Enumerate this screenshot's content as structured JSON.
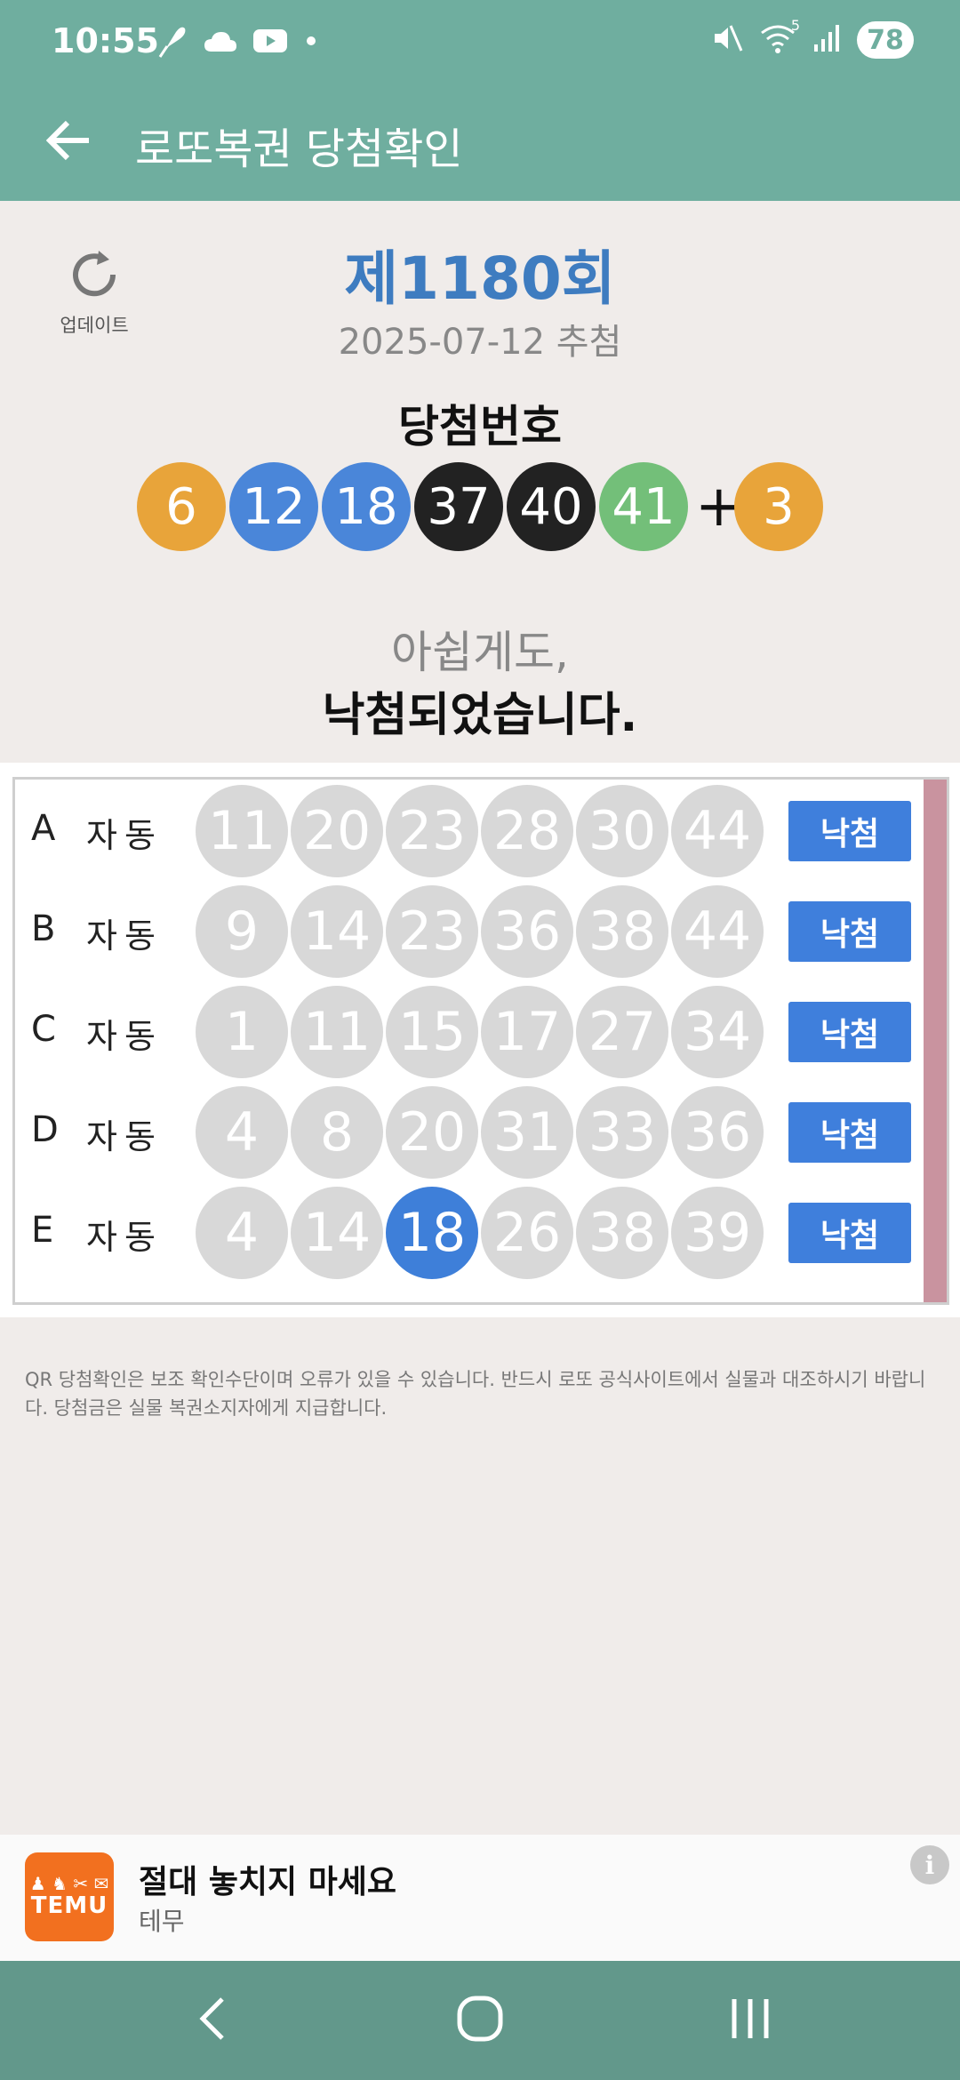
{
  "status_bar": {
    "time": "10:55",
    "left_icons": [
      "feather-icon",
      "cloud-icon",
      "youtube-icon",
      "dot-icon"
    ],
    "right_icons": [
      "mute-icon",
      "wifi-icon",
      "signal-icon"
    ],
    "wifi_label": "5",
    "battery": "78"
  },
  "app_bar": {
    "title": "로또복권 당첨확인",
    "back_icon": "back-arrow-icon"
  },
  "draw": {
    "update_label": "업데이트",
    "round": "제1180회",
    "date": "2025-07-12 추첨",
    "winning_label": "당첨번호",
    "numbers": [
      "6",
      "12",
      "18",
      "37",
      "40",
      "41"
    ],
    "number_colors": [
      "#e8a43a",
      "#4a86d9",
      "#4a86d9",
      "#222222",
      "#222222",
      "#73bf79"
    ],
    "plus": "+",
    "bonus": "3",
    "bonus_color": "#e8a43a",
    "message_line1": "아쉽게도,",
    "message_line2": "낙첨되었습니다."
  },
  "games": [
    {
      "letter": "A",
      "type": "자동",
      "numbers": [
        "11",
        "20",
        "23",
        "28",
        "30",
        "44"
      ],
      "hits": [
        false,
        false,
        false,
        false,
        false,
        false
      ],
      "result": "낙첨"
    },
    {
      "letter": "B",
      "type": "자동",
      "numbers": [
        "9",
        "14",
        "23",
        "36",
        "38",
        "44"
      ],
      "hits": [
        false,
        false,
        false,
        false,
        false,
        false
      ],
      "result": "낙첨"
    },
    {
      "letter": "C",
      "type": "자동",
      "numbers": [
        "1",
        "11",
        "15",
        "17",
        "27",
        "34"
      ],
      "hits": [
        false,
        false,
        false,
        false,
        false,
        false
      ],
      "result": "낙첨"
    },
    {
      "letter": "D",
      "type": "자동",
      "numbers": [
        "4",
        "8",
        "20",
        "31",
        "33",
        "36"
      ],
      "hits": [
        false,
        false,
        false,
        false,
        false,
        false
      ],
      "result": "낙첨"
    },
    {
      "letter": "E",
      "type": "자동",
      "numbers": [
        "4",
        "14",
        "18",
        "26",
        "38",
        "39"
      ],
      "hits": [
        false,
        false,
        true,
        false,
        false,
        false
      ],
      "result": "낙첨"
    }
  ],
  "disclaimer": "QR 당첨확인은 보조 확인수단이며 오류가 있을 수 있습니다. 반드시 로또 공식사이트에서 실물과 대조하시기 바랍니다. 당첨금은 실물 복권소지자에게 지급합니다.",
  "ad": {
    "logo_text": "TEMU",
    "title": "절대 놓치지 마세요",
    "subtitle": "테무",
    "info_glyph": "i"
  },
  "nav": {
    "icons": [
      "nav-back-icon",
      "nav-home-icon",
      "nav-recents-icon"
    ]
  },
  "colors": {
    "app_bar": "#6fae9f",
    "nav_bar": "#62988b",
    "accent_blue": "#3e7cc0",
    "button_blue": "#3f7fdc",
    "gray_ball": "#d8d8d8",
    "scroll_thumb": "#c9939f"
  }
}
